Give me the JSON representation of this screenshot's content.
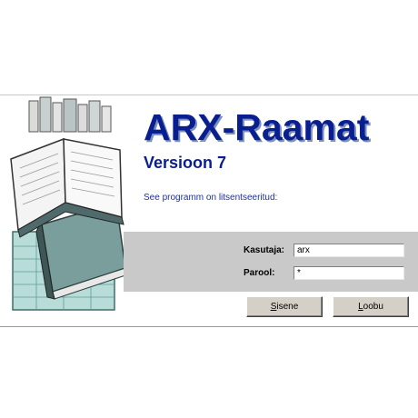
{
  "app": {
    "title": "ARX-Raamat",
    "version": "Versioon 7",
    "license_text": "See programm on litsentseeritud:"
  },
  "login": {
    "user_label": "Kasutaja:",
    "user_value": "arx",
    "password_label": "Parool:",
    "password_value": "*"
  },
  "buttons": {
    "ok_mnemonic": "S",
    "ok_rest": "isene",
    "cancel_mnemonic": "L",
    "cancel_rest": "oobu"
  },
  "colors": {
    "title_blue": "#0a1f8f",
    "band_gray": "#c9c9c9",
    "button_face": "#d4d0c8"
  },
  "icons": [
    "books-illustration"
  ]
}
